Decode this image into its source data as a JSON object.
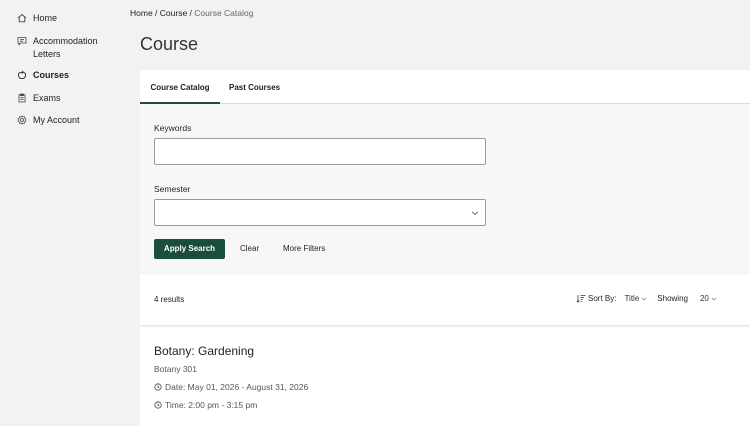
{
  "sidebar": {
    "items": [
      {
        "label": "Home",
        "icon": "home-icon"
      },
      {
        "label": "Accommodation Letters",
        "icon": "message-icon"
      },
      {
        "label": "Courses",
        "icon": "apple-icon",
        "active": true
      },
      {
        "label": "Exams",
        "icon": "clipboard-icon"
      },
      {
        "label": "My Account",
        "icon": "gear-icon"
      }
    ]
  },
  "breadcrumb": {
    "home": "Home",
    "sep1": " / ",
    "course": "Course",
    "sep2": " / ",
    "current": "Course Catalog"
  },
  "page": {
    "title": "Course"
  },
  "tabs": [
    {
      "label": "Course Catalog",
      "active": true
    },
    {
      "label": "Past Courses",
      "active": false
    }
  ],
  "search": {
    "keywords_label": "Keywords",
    "keywords_value": "",
    "semester_label": "Semester",
    "semester_value": "",
    "apply_label": "Apply Search",
    "clear_label": "Clear",
    "more_filters_label": "More Filters"
  },
  "results": {
    "count_text": "4 results",
    "sort_label": "Sort By:",
    "sort_value": "Title",
    "showing_label": "Showing",
    "showing_value": "20"
  },
  "courses": [
    {
      "title": "Botany: Gardening",
      "code": "Botany 301",
      "date": "Date: May 01, 2026 - August 31, 2026",
      "time": "Time: 2:00 pm - 3:15 pm"
    }
  ],
  "colors": {
    "accent": "#1a4d3a",
    "background": "#f2f2f2",
    "panel": "#ffffff"
  }
}
